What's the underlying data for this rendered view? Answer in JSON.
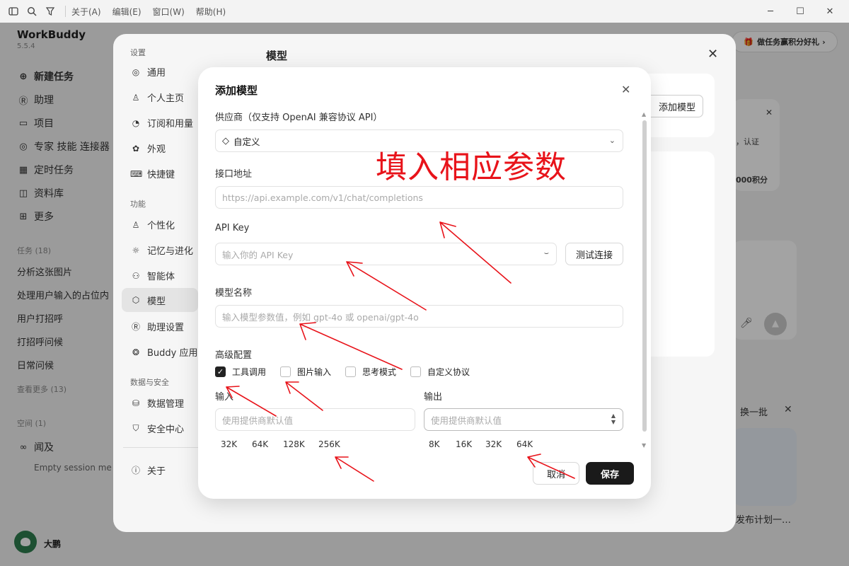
{
  "titlebar": {
    "menus": [
      "关于(A)",
      "编辑(E)",
      "窗口(W)",
      "帮助(H)"
    ]
  },
  "app": {
    "name": "WorkBuddy",
    "version": "5.5.4",
    "nav": [
      {
        "label": "新建任务",
        "icon": "plus-circle-icon"
      },
      {
        "label": "助理",
        "icon": "assistant-icon"
      },
      {
        "label": "项目",
        "icon": "folder-icon"
      },
      {
        "label": "专家 技能 连接器",
        "icon": "expert-icon"
      },
      {
        "label": "定时任务",
        "icon": "calendar-icon"
      },
      {
        "label": "资料库",
        "icon": "book-icon"
      },
      {
        "label": "更多",
        "icon": "grid-icon"
      }
    ],
    "tasks_label": "任务 (18)",
    "tasks": [
      "分析这张图片",
      "处理用户输入的占位内",
      "用户打招呼",
      "打招呼问候",
      "日常问候"
    ],
    "see_more": "查看更多 (13)",
    "space_label": "空间 (1)",
    "space_name": "闻及",
    "session": "Empty session me",
    "user": "大鹏"
  },
  "background": {
    "promo": "做任务赢积分好礼",
    "auth_fragment": "，认证",
    "points_fragment": "000积分",
    "refresh": "换一批",
    "plan_fragment": "发布计划一…"
  },
  "settings": {
    "title": "模型",
    "group_settings": "设置",
    "group_features": "功能",
    "group_data": "数据与安全",
    "items_settings": [
      "通用",
      "个人主页",
      "订阅和用量",
      "外观",
      "快捷键"
    ],
    "items_features": [
      "个性化",
      "记忆与进化",
      "智能体",
      "模型",
      "助理设置",
      "Buddy 应用"
    ],
    "items_data": [
      "数据管理",
      "安全中心"
    ],
    "about": "关于",
    "add_model_button": "添加模型"
  },
  "modal": {
    "title": "添加模型",
    "provider_label": "供应商（仅支持 OpenAI 兼容协议 API）",
    "provider_value": "自定义",
    "endpoint_label": "接口地址",
    "endpoint_placeholder": "https://api.example.com/v1/chat/completions",
    "apikey_label": "API Key",
    "apikey_placeholder": "输入你的 API Key",
    "test_button": "测试连接",
    "model_name_label": "模型名称",
    "model_name_placeholder": "输入模型参数值，例如 gpt-4o 或 openai/gpt-4o",
    "advanced_label": "高级配置",
    "options": [
      {
        "label": "工具调用",
        "checked": true
      },
      {
        "label": "图片输入",
        "checked": false
      },
      {
        "label": "思考模式",
        "checked": false
      },
      {
        "label": "自定义协议",
        "checked": false
      }
    ],
    "input_label": "输入",
    "input_placeholder": "使用提供商默认值",
    "input_presets": [
      "32K",
      "64K",
      "128K",
      "256K"
    ],
    "output_label": "输出",
    "output_placeholder": "使用提供商默认值",
    "output_presets": [
      "8K",
      "16K",
      "32K",
      "64K"
    ],
    "cancel_button": "取消",
    "save_button": "保存"
  },
  "annotation": {
    "text": "填入相应参数",
    "color": "#e8131a"
  }
}
